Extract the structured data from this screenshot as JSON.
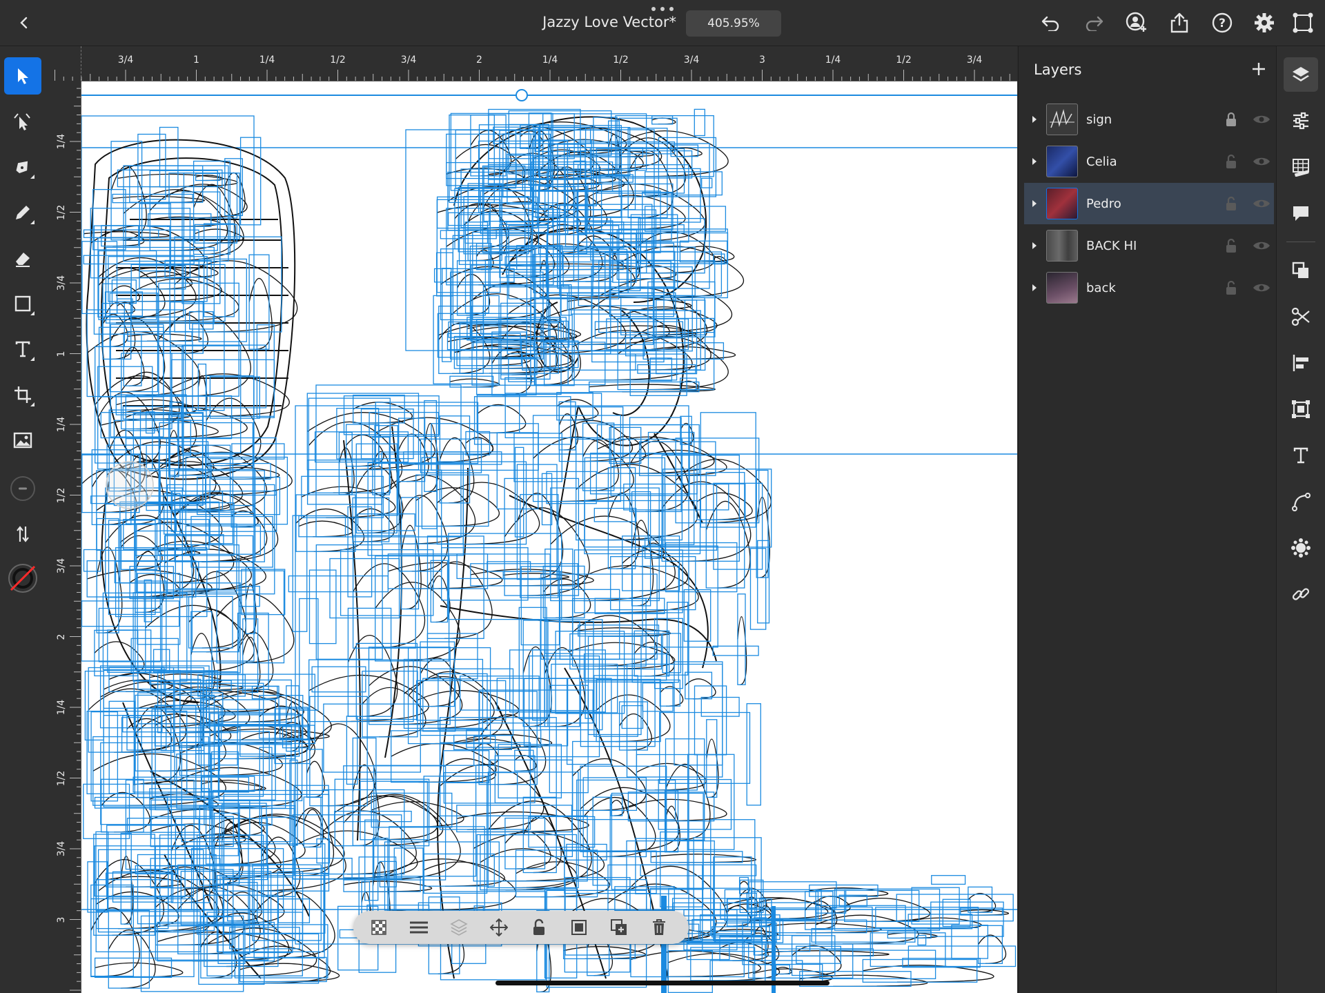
{
  "app": {
    "document_title": "Jazzy Love Vector*",
    "zoom_level": "405.95%"
  },
  "toolbar_top": {
    "icons": [
      "back-icon",
      "more-dots-icon",
      "undo-icon",
      "redo-icon",
      "invite-user-icon",
      "share-icon",
      "help-icon",
      "settings-icon",
      "touch-shortcut-icon"
    ]
  },
  "left_tools": [
    "select-tool",
    "node-tool",
    "pen-tool",
    "pencil-tool",
    "eraser-tool",
    "shape-tool",
    "text-tool",
    "crop-tool",
    "image-tool",
    "stroke-width",
    "swap-fill-stroke",
    "fill-stroke-color"
  ],
  "rulers": {
    "horizontal_labels": [
      "3/4",
      "1",
      "1/4",
      "1/2",
      "3/4",
      "2",
      "1/4",
      "1/2",
      "3/4",
      "3",
      "1/4",
      "1/2",
      "3/4"
    ],
    "vertical_labels": [
      "1/4",
      "1/2",
      "3/4",
      "1",
      "1/4",
      "1/2",
      "3/4",
      "2",
      "1/4",
      "1/2",
      "3/4",
      "3"
    ]
  },
  "layers_panel": {
    "title": "Layers",
    "layers": [
      {
        "name": "sign",
        "locked": true,
        "selected": false
      },
      {
        "name": "Celia",
        "locked": false,
        "selected": false
      },
      {
        "name": "Pedro",
        "locked": false,
        "selected": true
      },
      {
        "name": "BACK HI",
        "locked": false,
        "selected": false
      },
      {
        "name": "back",
        "locked": false,
        "selected": false
      }
    ]
  },
  "right_strip": [
    "layers-icon",
    "properties-icon",
    "grids-icon",
    "comments-icon",
    "combine-shapes-icon",
    "cut-icon",
    "align-icon",
    "repeat-grid-icon",
    "type-icon",
    "path-icon",
    "transform-icon",
    "link-icon"
  ],
  "float_bar": [
    "transparency-icon",
    "menu-icon",
    "layers-stack-icon",
    "move-icon",
    "unlock-icon",
    "mask-icon",
    "duplicate-icon",
    "delete-icon"
  ],
  "colors": {
    "accent": "#1473e6",
    "bounding_box": "#1b8ae0",
    "canvas": "#ffffff",
    "chrome": "#2f2f2f"
  }
}
